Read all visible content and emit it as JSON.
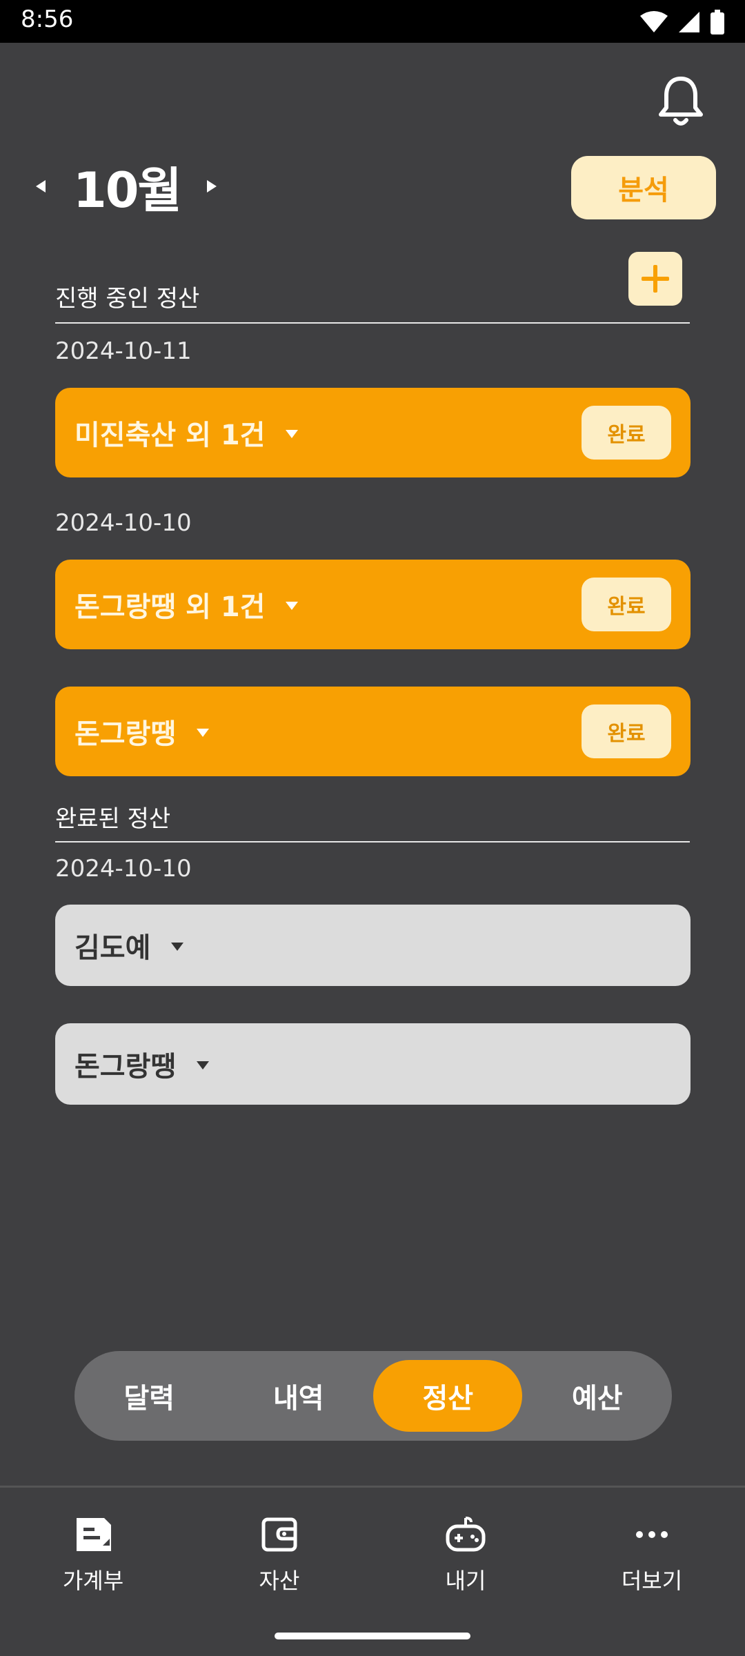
{
  "status_bar": {
    "time": "8:56"
  },
  "header": {
    "month": "10월",
    "analysis_label": "분석"
  },
  "in_progress": {
    "label": "진행 중인 정산",
    "groups": [
      {
        "date": "2024-10-11",
        "items": [
          {
            "title": "미진축산 외 1건",
            "done_label": "완료"
          }
        ]
      },
      {
        "date": "2024-10-10",
        "items": [
          {
            "title": "돈그랑땡 외 1건",
            "done_label": "완료"
          },
          {
            "title": "돈그랑땡",
            "done_label": "완료"
          }
        ]
      }
    ]
  },
  "completed": {
    "label": "완료된 정산",
    "groups": [
      {
        "date": "2024-10-10",
        "items": [
          {
            "title": "김도예"
          },
          {
            "title": "돈그랑땡"
          }
        ]
      }
    ]
  },
  "segments": [
    {
      "label": "달력"
    },
    {
      "label": "내역"
    },
    {
      "label": "정산",
      "active": true
    },
    {
      "label": "예산"
    }
  ],
  "bottom_nav": [
    {
      "label": "가계부",
      "icon": "ledger-icon"
    },
    {
      "label": "자산",
      "icon": "wallet-icon"
    },
    {
      "label": "내기",
      "icon": "gamepad-icon"
    },
    {
      "label": "더보기",
      "icon": "more-icon"
    }
  ],
  "colors": {
    "background": "#3f3f41",
    "accent": "#f8a003",
    "accent_light": "#fdeec5",
    "completed_card": "#dcdcdc"
  }
}
